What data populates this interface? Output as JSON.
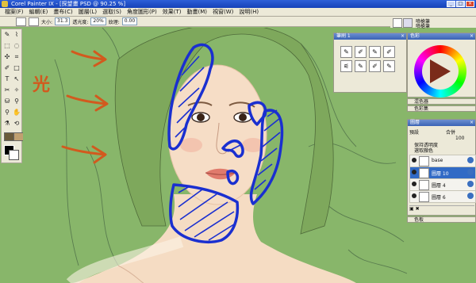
{
  "window": {
    "title": "Corel Painter IX - [探望畫 PSD @ 90.25 %]",
    "buttons": [
      "_",
      "□",
      "×"
    ]
  },
  "menu": [
    "檔案(F)",
    "編輯(E)",
    "畫布(C)",
    "圖層(L)",
    "選取(S)",
    "角度圖形(P)",
    "效果(T)",
    "動畫(M)",
    "視窗(W)",
    "說明(H)"
  ],
  "propbar": {
    "size_label": "大小:",
    "size_value": "31.3",
    "opacity_label": "透光度:",
    "opacity_value": "20%",
    "grain_label": "紋理:",
    "grain_value": "0.00"
  },
  "brush_selector": {
    "line1": "噴槍筆",
    "line2": "噴槍筆"
  },
  "panels": {
    "brush": {
      "title": "筆刷 1"
    },
    "color": {
      "title": "色彩"
    },
    "mixer": "混色器",
    "color_set": "色彩集",
    "layers": {
      "title": "圖層",
      "blend_mode": "預設",
      "composite": "合併",
      "opacity": "100",
      "option1": "保持透明度",
      "option2": "選取顏色",
      "items": [
        {
          "name": "base",
          "selected": false
        },
        {
          "name": "圖層 10",
          "selected": true
        },
        {
          "name": "圖層 4",
          "selected": false
        },
        {
          "name": "圖層 6",
          "selected": false
        }
      ]
    },
    "bottom": "色板"
  },
  "annotation": {
    "character": "光"
  },
  "colors": {
    "accent_blue": "#1a2fd0",
    "annotation_orange": "#d25a1e",
    "canvas_green": "#88b66a"
  }
}
